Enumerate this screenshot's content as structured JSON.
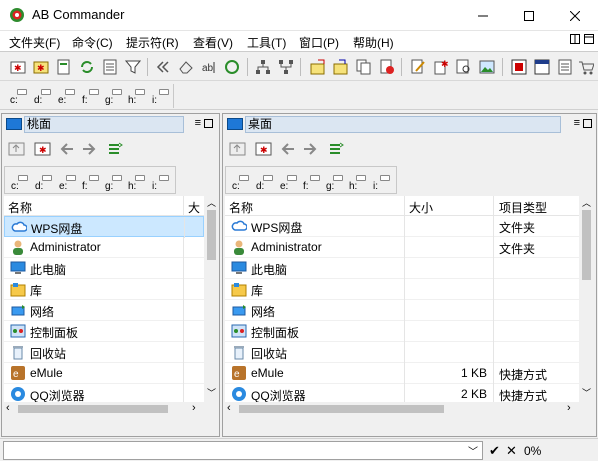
{
  "window": {
    "title": "AB Commander"
  },
  "menu": [
    "文件夹(F)",
    "命令(C)",
    "提示符(R)",
    "查看(V)",
    "工具(T)",
    "窗口(P)",
    "帮助(H)"
  ],
  "drives": [
    "c:",
    "d:",
    "e:",
    "f:",
    "g:",
    "h:",
    "i:"
  ],
  "panes": [
    {
      "path": "桃面",
      "header_menu": "≡",
      "columns": [
        "名称",
        "大"
      ],
      "rows": [
        {
          "name": "WPS网盘",
          "icon": "cloud-icon",
          "size": "",
          "type": "",
          "selected": true
        },
        {
          "name": "Administrator",
          "icon": "user-icon",
          "size": "",
          "type": ""
        },
        {
          "name": "此电脑",
          "icon": "computer-icon",
          "size": "",
          "type": ""
        },
        {
          "name": "库",
          "icon": "library-icon",
          "size": "",
          "type": ""
        },
        {
          "name": "网络",
          "icon": "network-icon",
          "size": "",
          "type": ""
        },
        {
          "name": "控制面板",
          "icon": "control-panel-icon",
          "size": "",
          "type": ""
        },
        {
          "name": "回收站",
          "icon": "recycle-bin-icon",
          "size": "",
          "type": ""
        },
        {
          "name": "eMule",
          "icon": "emule-icon",
          "size": "",
          "type": ""
        },
        {
          "name": "QQ浏览器",
          "icon": "qq-browser-icon",
          "size": "",
          "type": ""
        }
      ]
    },
    {
      "path": "桌面",
      "header_menu": "≡",
      "columns": [
        "名称",
        "大小",
        "项目类型"
      ],
      "rows": [
        {
          "name": "WPS网盘",
          "icon": "cloud-icon",
          "size": "",
          "type": "文件夹"
        },
        {
          "name": "Administrator",
          "icon": "user-icon",
          "size": "",
          "type": "文件夹"
        },
        {
          "name": "此电脑",
          "icon": "computer-icon",
          "size": "",
          "type": ""
        },
        {
          "name": "库",
          "icon": "library-icon",
          "size": "",
          "type": ""
        },
        {
          "name": "网络",
          "icon": "network-icon",
          "size": "",
          "type": ""
        },
        {
          "name": "控制面板",
          "icon": "control-panel-icon",
          "size": "",
          "type": ""
        },
        {
          "name": "回收站",
          "icon": "recycle-bin-icon",
          "size": "",
          "type": ""
        },
        {
          "name": "eMule",
          "icon": "emule-icon",
          "size": "1 KB",
          "type": "快捷方式"
        },
        {
          "name": "QQ浏览器",
          "icon": "qq-browser-icon",
          "size": "2 KB",
          "type": "快捷方式"
        }
      ]
    }
  ],
  "status": {
    "percent": "0%",
    "ok": "✔",
    "cancel": "✕"
  }
}
